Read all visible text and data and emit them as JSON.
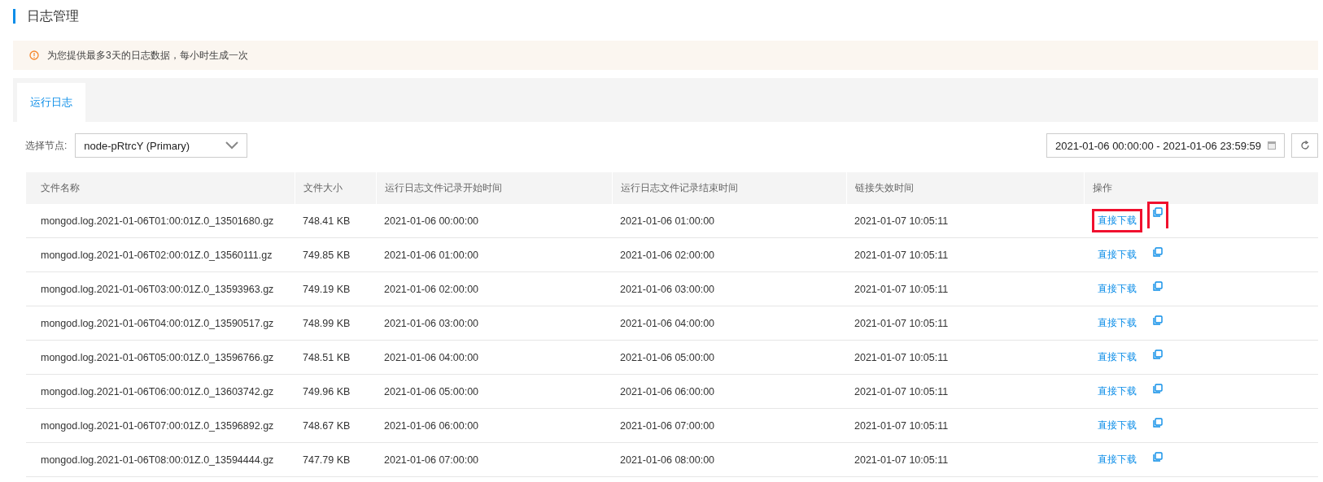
{
  "page_title": "日志管理",
  "notice": {
    "text": "为您提供最多3天的日志数据，每小时生成一次"
  },
  "tabs": [
    {
      "label": "运行日志",
      "selected": true
    }
  ],
  "node_select": {
    "label": "选择节点:",
    "value": "node-pRtrcY (Primary)"
  },
  "date_range": {
    "value": "2021-01-06 00:00:00 - 2021-01-06 23:59:59"
  },
  "table": {
    "columns": [
      "文件名称",
      "文件大小",
      "运行日志文件记录开始时间",
      "运行日志文件记录结束时间",
      "链接失效时间",
      "操作"
    ],
    "rows": [
      {
        "name": "mongod.log.2021-01-06T01:00:01Z.0_13501680.gz",
        "size": "748.41 KB",
        "start": "2021-01-06 00:00:00",
        "end": "2021-01-06 01:00:00",
        "expire": "2021-01-07 10:05:11",
        "action": "直接下载",
        "highlighted": true
      },
      {
        "name": "mongod.log.2021-01-06T02:00:01Z.0_13560111.gz",
        "size": "749.85 KB",
        "start": "2021-01-06 01:00:00",
        "end": "2021-01-06 02:00:00",
        "expire": "2021-01-07 10:05:11",
        "action": "直接下载",
        "highlighted": false
      },
      {
        "name": "mongod.log.2021-01-06T03:00:01Z.0_13593963.gz",
        "size": "749.19 KB",
        "start": "2021-01-06 02:00:00",
        "end": "2021-01-06 03:00:00",
        "expire": "2021-01-07 10:05:11",
        "action": "直接下载",
        "highlighted": false
      },
      {
        "name": "mongod.log.2021-01-06T04:00:01Z.0_13590517.gz",
        "size": "748.99 KB",
        "start": "2021-01-06 03:00:00",
        "end": "2021-01-06 04:00:00",
        "expire": "2021-01-07 10:05:11",
        "action": "直接下载",
        "highlighted": false
      },
      {
        "name": "mongod.log.2021-01-06T05:00:01Z.0_13596766.gz",
        "size": "748.51 KB",
        "start": "2021-01-06 04:00:00",
        "end": "2021-01-06 05:00:00",
        "expire": "2021-01-07 10:05:11",
        "action": "直接下载",
        "highlighted": false
      },
      {
        "name": "mongod.log.2021-01-06T06:00:01Z.0_13603742.gz",
        "size": "749.96 KB",
        "start": "2021-01-06 05:00:00",
        "end": "2021-01-06 06:00:00",
        "expire": "2021-01-07 10:05:11",
        "action": "直接下载",
        "highlighted": false
      },
      {
        "name": "mongod.log.2021-01-06T07:00:01Z.0_13596892.gz",
        "size": "748.67 KB",
        "start": "2021-01-06 06:00:00",
        "end": "2021-01-06 07:00:00",
        "expire": "2021-01-07 10:05:11",
        "action": "直接下载",
        "highlighted": false
      },
      {
        "name": "mongod.log.2021-01-06T08:00:01Z.0_13594444.gz",
        "size": "747.79 KB",
        "start": "2021-01-06 07:00:00",
        "end": "2021-01-06 08:00:00",
        "expire": "2021-01-07 10:05:11",
        "action": "直接下载",
        "highlighted": false
      }
    ]
  }
}
